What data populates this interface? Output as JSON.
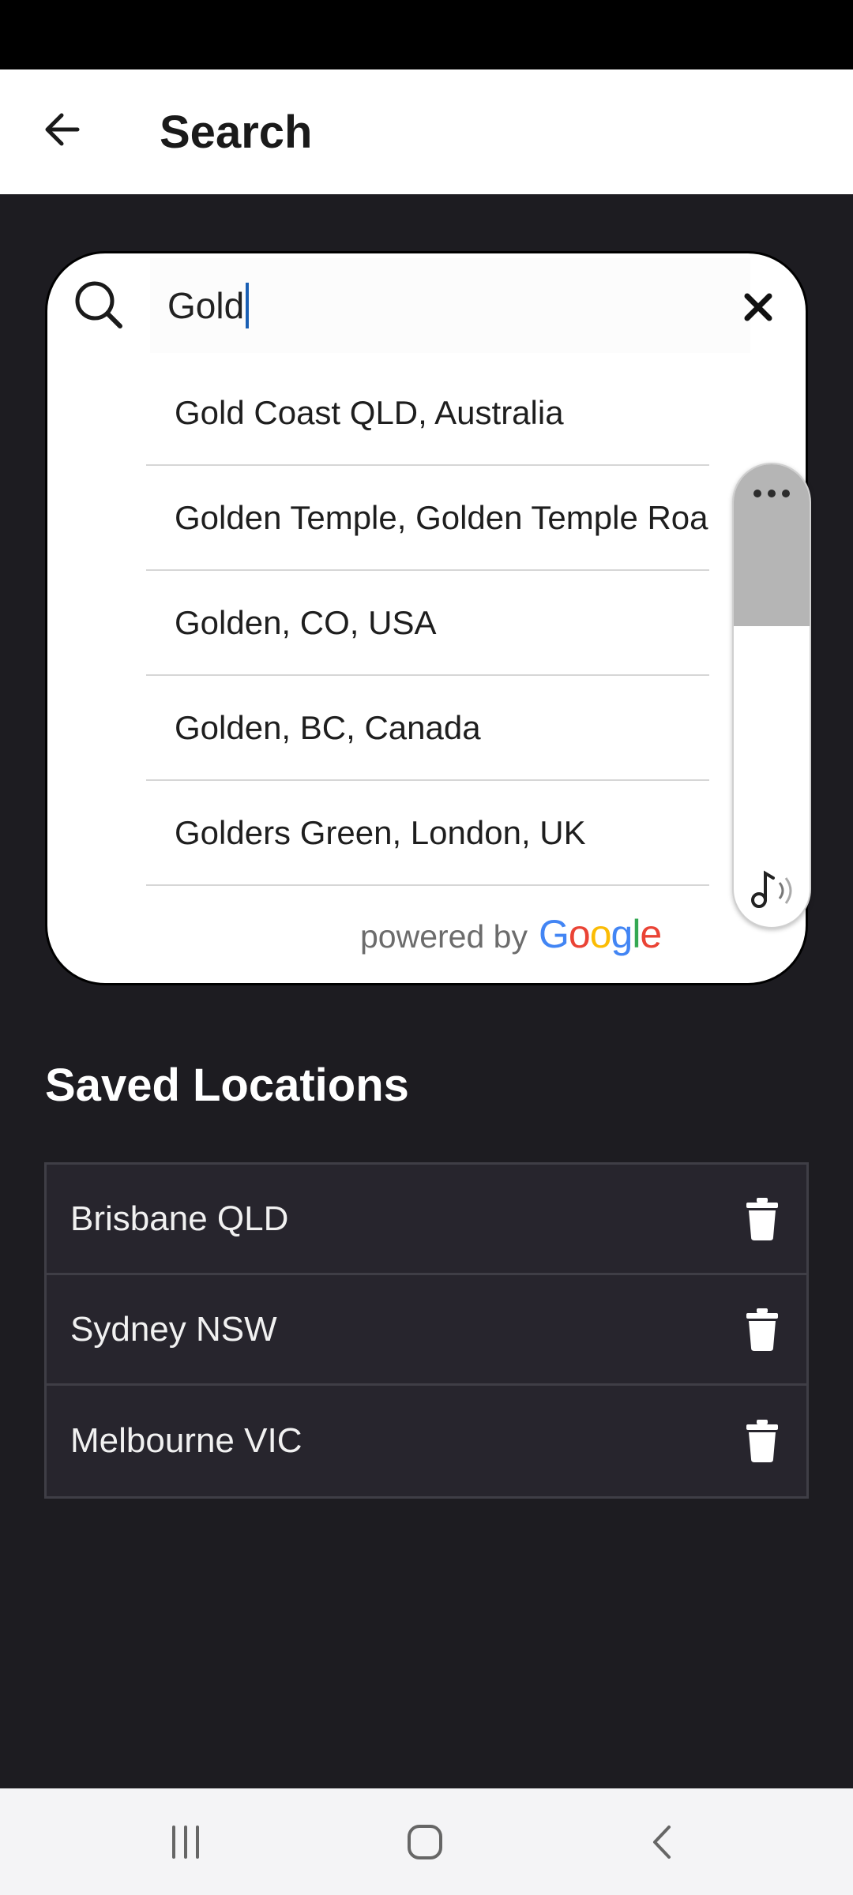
{
  "app_bar": {
    "title": "Search"
  },
  "search": {
    "value": "Gold",
    "suggestions": [
      "Gold Coast QLD, Australia",
      "Golden Temple, Golden Temple Road",
      "Golden, CO, USA",
      "Golden, BC, Canada",
      "Golders Green, London, UK"
    ],
    "attribution_prefix": "powered by",
    "attribution_brand": [
      "G",
      "o",
      "o",
      "g",
      "l",
      "e"
    ]
  },
  "side_widget": {
    "fill_fraction": 0.35
  },
  "saved": {
    "title": "Saved Locations",
    "items": [
      "Brisbane QLD",
      "Sydney NSW",
      "Melbourne VIC"
    ]
  },
  "icons": {
    "back": "arrow-left-icon",
    "search": "search-icon",
    "clear": "close-icon",
    "delete": "trash-icon",
    "more": "more-horizontal-icon",
    "audio": "music-note-icon",
    "nav_recents": "recents-icon",
    "nav_home": "home-icon",
    "nav_back": "chevron-left-icon"
  }
}
